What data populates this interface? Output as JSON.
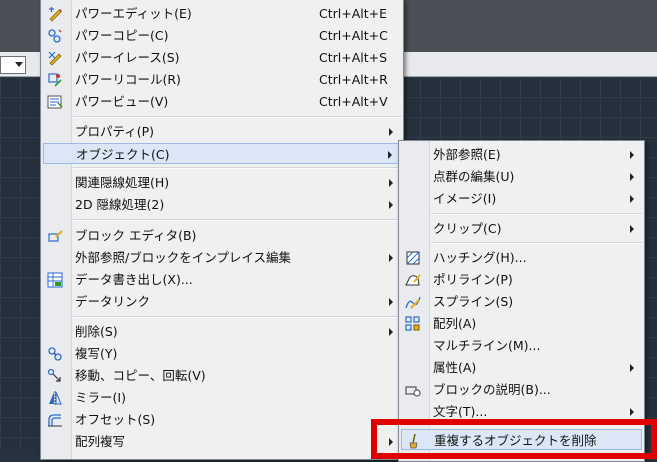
{
  "main_menu": {
    "items": [
      {
        "label": "パワーエディット(E)",
        "shortcut": "Ctrl+Alt+E",
        "icon": "power-edit-icon"
      },
      {
        "label": "パワーコピー(C)",
        "shortcut": "Ctrl+Alt+C",
        "icon": "power-copy-icon"
      },
      {
        "label": "パワーイレース(S)",
        "shortcut": "Ctrl+Alt+S",
        "icon": "power-erase-icon"
      },
      {
        "label": "パワーリコール(R)",
        "shortcut": "Ctrl+Alt+R",
        "icon": "power-recall-icon"
      },
      {
        "label": "パワービュー(V)",
        "shortcut": "Ctrl+Alt+V",
        "icon": "power-view-icon"
      },
      {
        "label": "プロパティ(P)"
      },
      {
        "label": "オブジェクト(C)"
      },
      {
        "label": "関連隠線処理(H)"
      },
      {
        "label": "2D 隠線処理(2)"
      },
      {
        "label": "ブロック エディタ(B)",
        "icon": "block-editor-icon"
      },
      {
        "label": "外部参照/ブロックをインプレイス編集"
      },
      {
        "label": "データ書き出し(X)...",
        "icon": "data-extract-icon"
      },
      {
        "label": "データリンク"
      },
      {
        "label": "削除(S)"
      },
      {
        "label": "複写(Y)",
        "icon": "copy-icon"
      },
      {
        "label": "移動、コピー、回転(V)",
        "icon": "move-copy-rotate-icon"
      },
      {
        "label": "ミラー(I)",
        "icon": "mirror-icon"
      },
      {
        "label": "オフセット(S)",
        "icon": "offset-icon"
      },
      {
        "label": "配列複写"
      }
    ]
  },
  "sub_menu": {
    "items": [
      {
        "label": "外部参照(E)"
      },
      {
        "label": "点群の編集(U)"
      },
      {
        "label": "イメージ(I)"
      },
      {
        "label": "クリップ(C)"
      },
      {
        "label": "ハッチング(H)...",
        "icon": "hatch-icon"
      },
      {
        "label": "ポリライン(P)",
        "icon": "polyline-icon"
      },
      {
        "label": "スプライン(S)",
        "icon": "spline-icon"
      },
      {
        "label": "配列(A)",
        "icon": "array-icon"
      },
      {
        "label": "マルチライン(M)..."
      },
      {
        "label": "属性(A)"
      },
      {
        "label": "ブロックの説明(B)...",
        "icon": "block-description-icon"
      },
      {
        "label": "文字(T)..."
      },
      {
        "label": "重複するオブジェクトを削除",
        "icon": "overkill-icon"
      }
    ]
  },
  "colors": {
    "highlight_box": "#e00000",
    "menu_bg": "#f0f0f0",
    "active_item": "#dbe7f7"
  }
}
